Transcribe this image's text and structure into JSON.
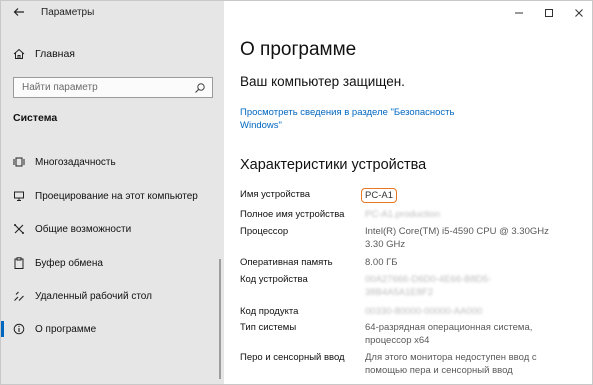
{
  "app_title": "Параметры",
  "sidebar": {
    "home_label": "Главная",
    "search_placeholder": "Найти параметр",
    "section_title": "Система",
    "items": [
      {
        "label": "Многозадачность",
        "icon": "multitasking-icon"
      },
      {
        "label": "Проецирование на этот компьютер",
        "icon": "projecting-icon"
      },
      {
        "label": "Общие возможности",
        "icon": "shared-experiences-icon"
      },
      {
        "label": "Буфер обмена",
        "icon": "clipboard-icon"
      },
      {
        "label": "Удаленный рабочий стол",
        "icon": "remote-desktop-icon"
      },
      {
        "label": "О программе",
        "icon": "info-icon",
        "active": true
      }
    ]
  },
  "main": {
    "page_title": "О программе",
    "protected_text": "Ваш компьютер защищен.",
    "security_link": "Просмотреть сведения в разделе \"Безопасность Windows\"",
    "specs_title": "Характеристики устройства",
    "specs": {
      "device_name": {
        "label": "Имя устройства",
        "value": "PC-A1"
      },
      "full_device_name": {
        "label": "Полное имя устройства",
        "value": "PC-A1.production"
      },
      "processor": {
        "label": "Процессор",
        "value": "Intel(R) Core(TM) i5-4590 CPU @ 3.30GHz 3.30 GHz"
      },
      "ram": {
        "label": "Оперативная память",
        "value": "8.00 ГБ"
      },
      "device_id": {
        "label": "Код устройства",
        "value": "00A27666-D6D0-4E66-B8D5-38B4A5A1E8F2"
      },
      "product_id": {
        "label": "Код продукта",
        "value": "00330-80000-00000-AA000"
      },
      "system_type": {
        "label": "Тип системы",
        "value": "64-разрядная операционная система, процессор x64"
      },
      "pen_touch": {
        "label": "Перо и сенсорный ввод",
        "value": "Для этого монитора недоступен ввод с помощью пера и сенсорный ввод"
      }
    }
  },
  "colors": {
    "accent": "#0067c0",
    "highlight": "#e87722",
    "sidebar_bg": "#e6e6e6"
  }
}
